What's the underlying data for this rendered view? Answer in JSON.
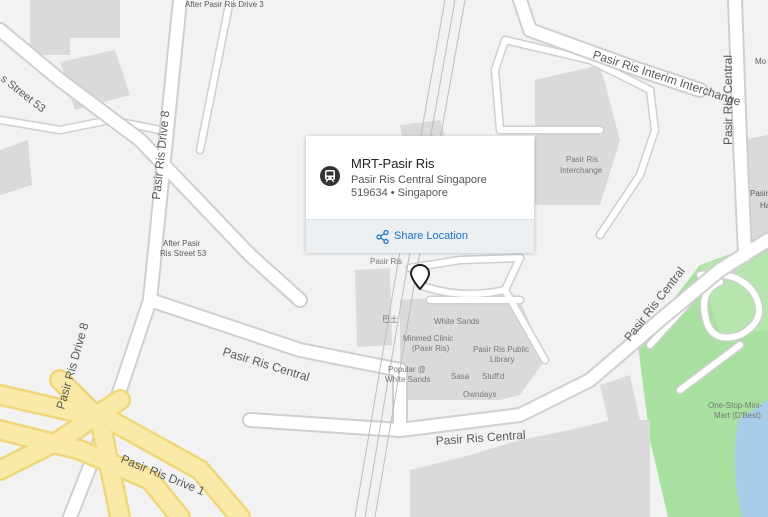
{
  "map": {
    "roads": {
      "pasir_ris_drive_8": "Pasir Ris Drive 8",
      "pasir_ris_street_53": "Pasir Ris Street 53",
      "pasir_ris_central": "Pasir Ris Central",
      "pasir_ris_drive_1": "Pasir Ris Drive 1",
      "pasir_ris_interim_interchange": "Pasir Ris Interim Interchange",
      "after_pasir_ris_drive_3": "After Pasir Ris Drive 3",
      "after_pasir_ris_street_53_line1": "After Pasir",
      "after_pasir_ris_street_53_line2": "Ris Street 53",
      "street_53_partial": "s Street 53",
      "mo_partial": "Mo",
      "pasir_partial": "Pasir",
      "ha_partial": "Ha"
    },
    "pois": {
      "pasir_ris_interchange_line1": "Pasir Ris",
      "pasir_ris_interchange_line2": "Interchange",
      "white_sands": "White Sands",
      "minmed_line1": "Minmed Clinic",
      "minmed_line2": "(Pasir Ris)",
      "library_line1": "Pasir Ris Public",
      "library_line2": "Library",
      "popular_line1": "Popular @",
      "popular_line2": "White Sands",
      "sasa": "Sasa",
      "stuffd": "Stuff'd",
      "owndays": "Owndays",
      "pasir_ris_station": "Pasir Ris",
      "chinese_label": "巴士",
      "one_stop_line1": "One-Stop-Mini-",
      "one_stop_line2": "Mart (D'Best)"
    }
  },
  "popup": {
    "title": "MRT-Pasir Ris",
    "address_line1": "Pasir Ris Central Singapore",
    "address_line2": "519634 • Singapore",
    "icon": "train-icon",
    "share_label": "Share Location",
    "share_icon": "share-icon"
  },
  "marker": {
    "icon": "location-pin-icon"
  },
  "colors": {
    "background": "#f2f2f2",
    "road": "#ffffff",
    "road_edge": "#cfcfcf",
    "highway": "#fbe9a8",
    "building": "#dadada",
    "park": "#a8e0a0",
    "water": "#a9cde8",
    "link": "#1a73c8"
  }
}
